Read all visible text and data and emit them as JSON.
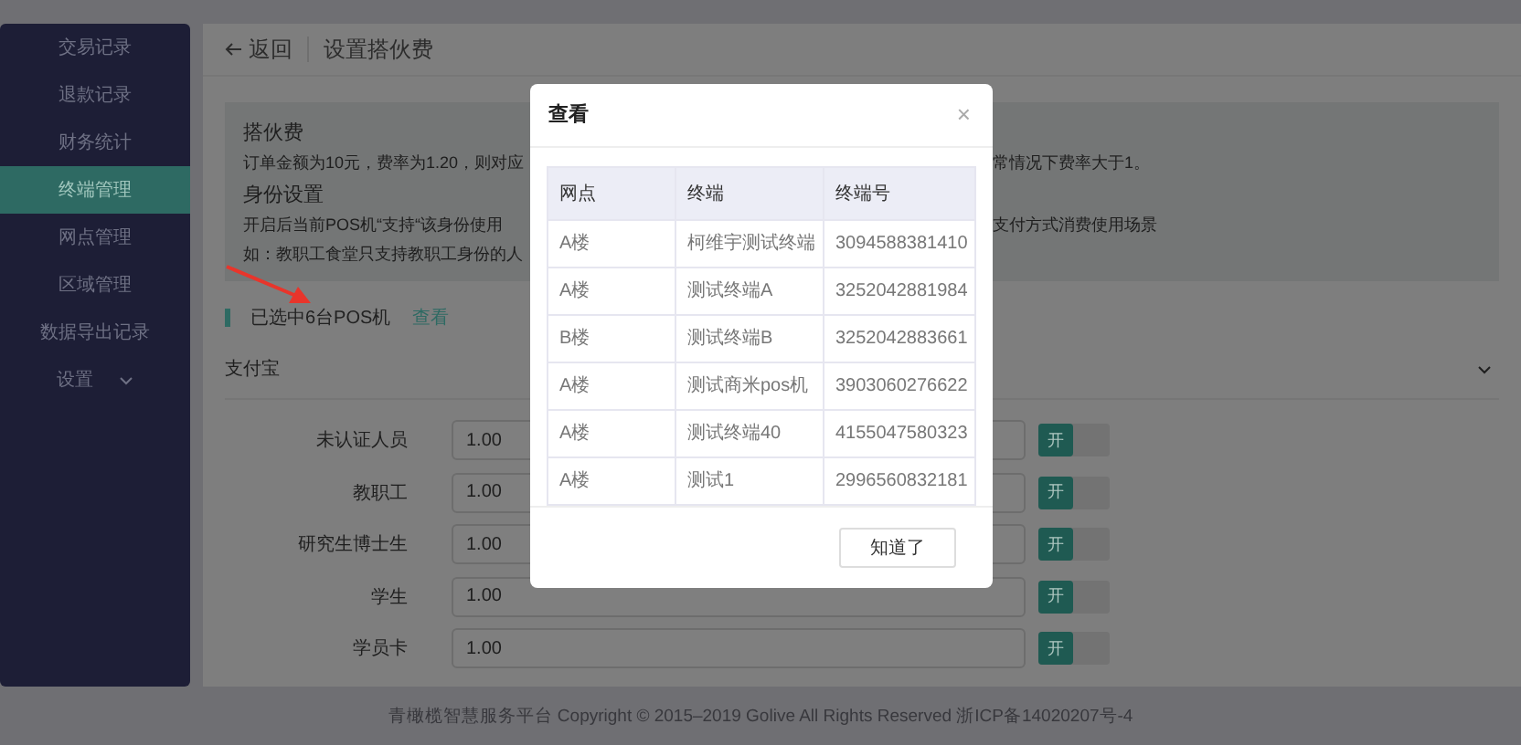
{
  "sidebar": {
    "items": [
      {
        "label": "交易记录",
        "selected": false,
        "kind": "link"
      },
      {
        "label": "退款记录",
        "selected": false,
        "kind": "link"
      },
      {
        "label": "财务统计",
        "selected": false,
        "kind": "link"
      },
      {
        "label": "终端管理",
        "selected": true,
        "kind": "link"
      },
      {
        "label": "网点管理",
        "selected": false,
        "kind": "link"
      },
      {
        "label": "区域管理",
        "selected": false,
        "kind": "link"
      },
      {
        "label": "数据导出记录",
        "selected": false,
        "kind": "link"
      },
      {
        "label": "设置",
        "selected": false,
        "kind": "group"
      }
    ]
  },
  "header": {
    "back": "返回",
    "title": "设置搭伙费"
  },
  "info": [
    {
      "heading": "搭伙费",
      "lines": [
        {
          "left": "订单金额为10元，费率为1.20，则对应",
          "right": "常情况下费率大于1。"
        }
      ]
    },
    {
      "heading": "身份设置",
      "lines": [
        {
          "left": "开启后当前POS机“支持“该身份使用",
          "right": "支付方式消费使用场景"
        },
        {
          "left": "如：教职工食堂只支持教职工身份的人"
        }
      ]
    }
  ],
  "selection": {
    "text": "已选中6台POS机",
    "link": "查看"
  },
  "section": {
    "title": "支付宝",
    "expanded": true
  },
  "rows": [
    {
      "label": "未认证人员",
      "value": "1.00",
      "switch_label": "开",
      "on": true
    },
    {
      "label": "教职工",
      "value": "1.00",
      "switch_label": "开",
      "on": true
    },
    {
      "label": "研究生博士生",
      "value": "1.00",
      "switch_label": "开",
      "on": true
    },
    {
      "label": "学生",
      "value": "1.00",
      "switch_label": "开",
      "on": true
    },
    {
      "label": "学员卡",
      "value": "1.00",
      "switch_label": "开",
      "on": true
    }
  ],
  "footer": "青橄榄智慧服务平台 Copyright © 2015–2019 Golive All Rights Reserved  浙ICP备14020207号-4",
  "modal": {
    "title": "查看",
    "close": "×",
    "columns": [
      "网点",
      "终端",
      "终端号"
    ],
    "rows": [
      [
        "A楼",
        "柯维宇测试终端",
        "3094588381410"
      ],
      [
        "A楼",
        "测试终端A",
        "3252042881984"
      ],
      [
        "B楼",
        "测试终端B",
        "3252042883661"
      ],
      [
        "A楼",
        "测试商米pos机",
        "3903060276622"
      ],
      [
        "A楼",
        "测试终端40",
        "4155047580323"
      ],
      [
        "A楼",
        "测试1",
        "2996560832181"
      ]
    ],
    "button": "知道了"
  }
}
